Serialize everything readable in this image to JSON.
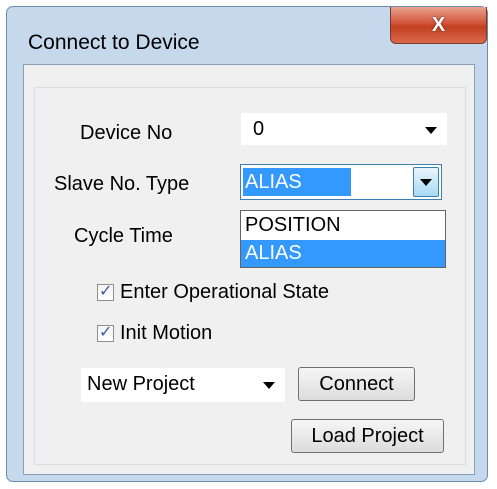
{
  "window": {
    "title": "Connect to Device",
    "close_glyph": "X"
  },
  "form": {
    "device_no_label": "Device No",
    "device_no_value": "0",
    "slave_type_label": "Slave No. Type",
    "slave_type_value": "ALIAS",
    "slave_type_options": [
      "POSITION",
      "ALIAS"
    ],
    "cycle_time_label": "Cycle Time",
    "enter_operational_label": "Enter Operational State",
    "enter_operational_checked": true,
    "init_motion_label": "Init Motion",
    "init_motion_checked": true,
    "project_value": "New Project",
    "connect_label": "Connect",
    "load_project_label": "Load Project"
  },
  "icons": {
    "close": "close-icon",
    "dropdown": "chevron-down-icon",
    "check": "checkmark-icon"
  },
  "colors": {
    "selection": "#3399ff",
    "close_button": "#c1401f",
    "frame": "#c6d8ec"
  }
}
